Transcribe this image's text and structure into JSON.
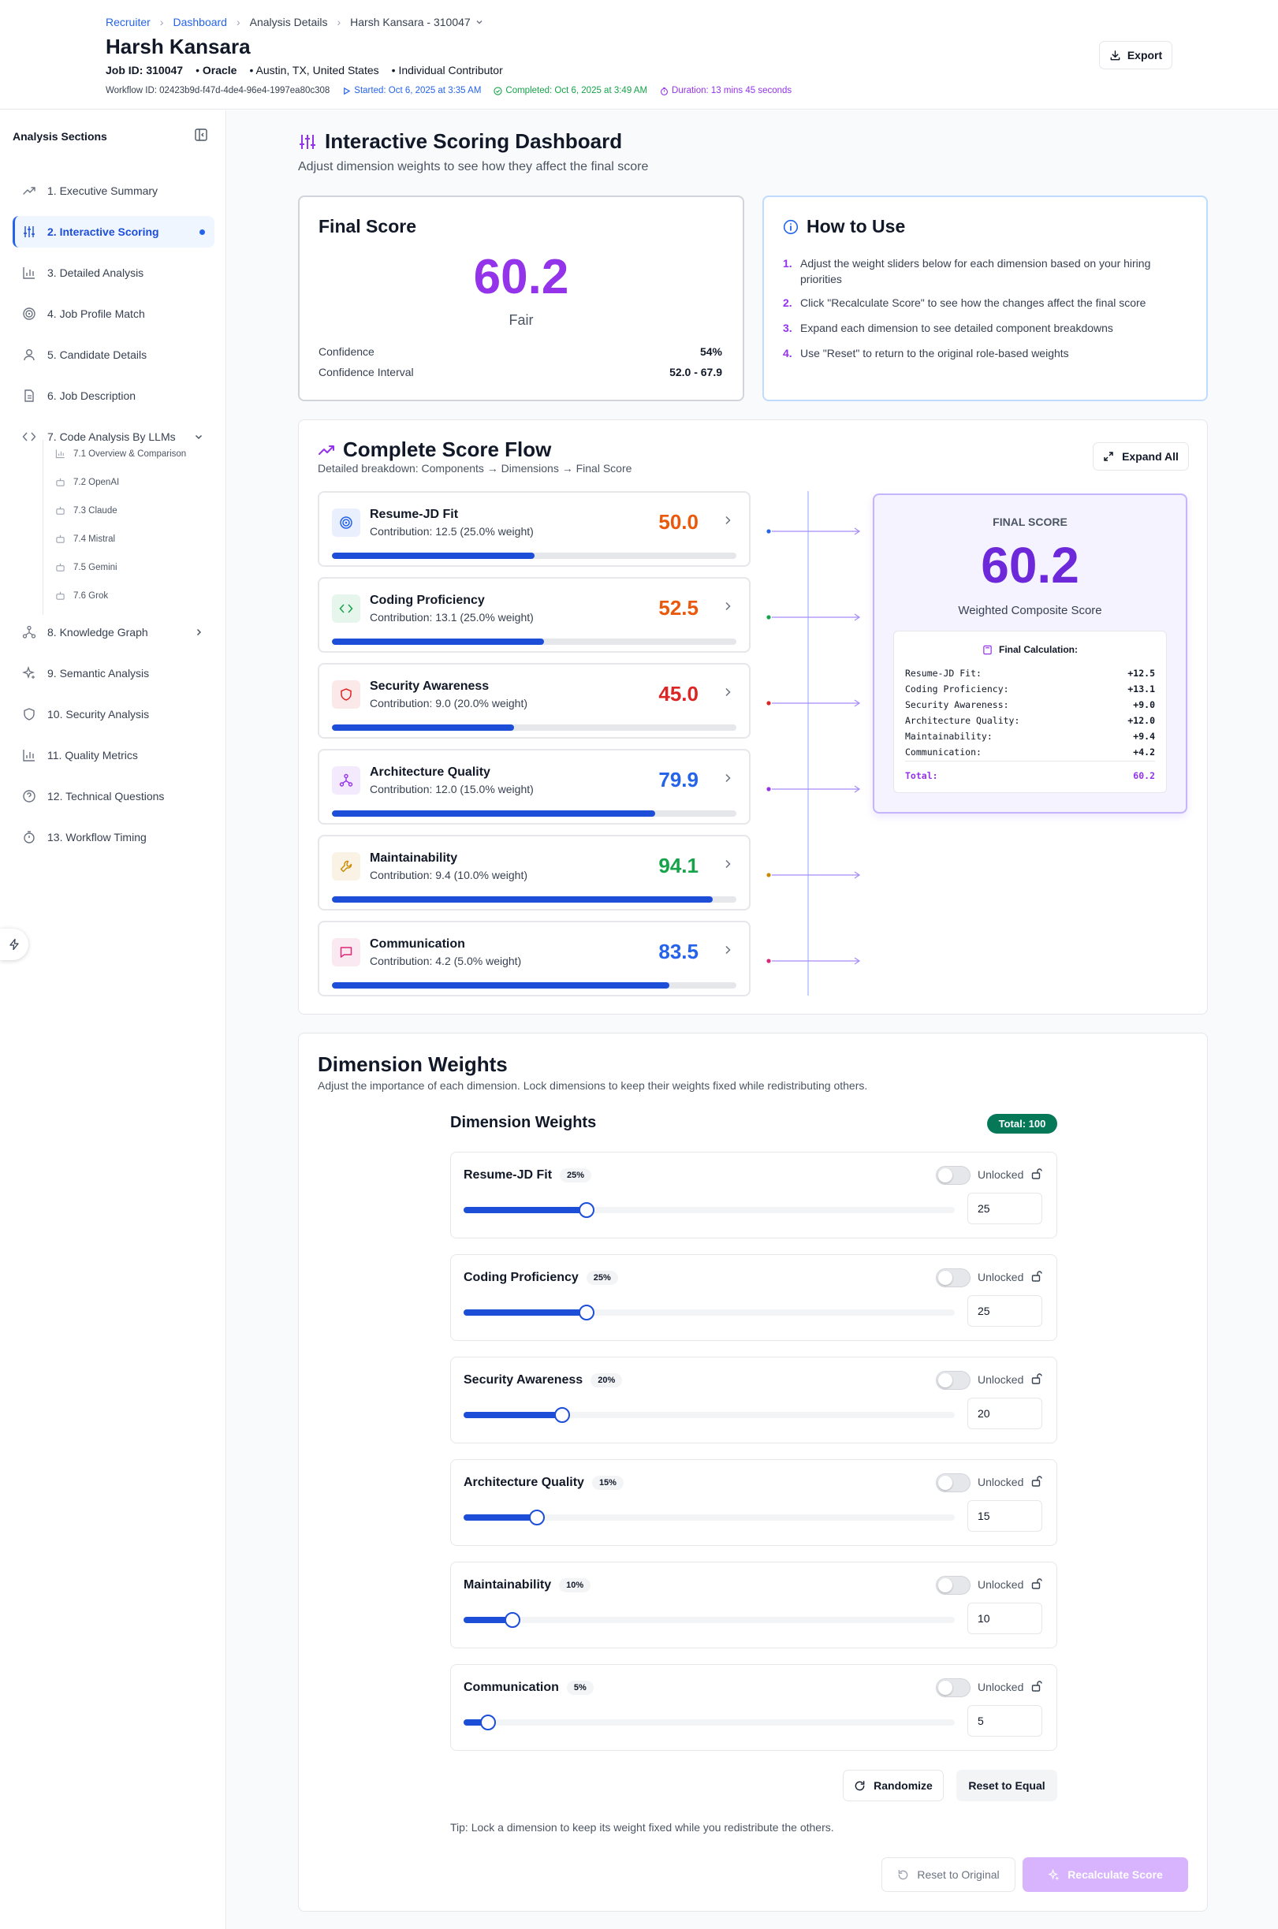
{
  "header": {
    "breadcrumb": [
      "Recruiter",
      "Dashboard",
      "Analysis Details",
      "Harsh Kansara - 310047"
    ],
    "candidate_name": "Harsh Kansara",
    "job_id": "Job ID: 310047",
    "company": "Oracle",
    "location": "Austin, TX, United States",
    "role": "Individual Contributor",
    "workflow_id": "Workflow ID: 02423b9d-f47d-4de4-96e4-1997ea80c308",
    "started": "Started: Oct 6, 2025 at 3:35 AM",
    "completed": "Completed: Oct 6, 2025 at 3:49 AM",
    "duration": "Duration: 13 mins 45 seconds",
    "export_label": "Export"
  },
  "sidebar": {
    "title": "Analysis Sections",
    "items": [
      {
        "label": "1. Executive Summary",
        "icon": "trending-up-icon"
      },
      {
        "label": "2. Interactive Scoring",
        "icon": "sliders-icon"
      },
      {
        "label": "3. Detailed Analysis",
        "icon": "bar-chart-icon"
      },
      {
        "label": "4. Job Profile Match",
        "icon": "target-icon"
      },
      {
        "label": "5. Candidate Details",
        "icon": "user-icon"
      },
      {
        "label": "6. Job Description",
        "icon": "file-icon"
      },
      {
        "label": "7. Code Analysis By LLMs",
        "icon": "code-icon"
      },
      {
        "label": "8. Knowledge Graph",
        "icon": "network-icon"
      },
      {
        "label": "9. Semantic Analysis",
        "icon": "sparkles-icon"
      },
      {
        "label": "10. Security Analysis",
        "icon": "shield-icon"
      },
      {
        "label": "11. Quality Metrics",
        "icon": "bar-chart-icon"
      },
      {
        "label": "12. Technical Questions",
        "icon": "help-circle-icon"
      },
      {
        "label": "13. Workflow Timing",
        "icon": "timer-icon"
      }
    ],
    "sub_items": [
      "7.1 Overview & Comparison",
      "7.2 OpenAI",
      "7.3 Claude",
      "7.4 Mistral",
      "7.5 Gemini",
      "7.6 Grok"
    ]
  },
  "page": {
    "title": "Interactive Scoring Dashboard",
    "subtitle": "Adjust dimension weights to see how they affect the final score"
  },
  "final_score": {
    "title": "Final Score",
    "value": "60.2",
    "rating": "Fair",
    "confidence_label": "Confidence",
    "confidence_value": "54%",
    "interval_label": "Confidence Interval",
    "interval_value": "52.0 - 67.9"
  },
  "how_to": {
    "title": "How to Use",
    "steps": [
      "Adjust the weight sliders below for each dimension based on your hiring priorities",
      "Click \"Recalculate Score\" to see how the changes affect the final score",
      "Expand each dimension to see detailed component breakdowns",
      "Use \"Reset\" to return to the original role-based weights"
    ]
  },
  "flow": {
    "title": "Complete Score Flow",
    "subtitle": "Detailed breakdown: Components → Dimensions → Final Score",
    "expand_label": "Expand All",
    "components": [
      {
        "name": "Resume-JD Fit",
        "contribution": "Contribution: 12.5 (25.0% weight)",
        "score": "50.0",
        "progress": 0.5,
        "score_color": "#ea580c",
        "accent": "#2563eb",
        "icon": "target-icon"
      },
      {
        "name": "Coding Proficiency",
        "contribution": "Contribution: 13.1 (25.0% weight)",
        "score": "52.5",
        "progress": 0.525,
        "score_color": "#ea580c",
        "accent": "#16a34a",
        "icon": "code-icon"
      },
      {
        "name": "Security Awareness",
        "contribution": "Contribution: 9.0 (20.0% weight)",
        "score": "45.0",
        "progress": 0.45,
        "score_color": "#dc2626",
        "accent": "#dc2626",
        "icon": "shield-icon"
      },
      {
        "name": "Architecture Quality",
        "contribution": "Contribution: 12.0 (15.0% weight)",
        "score": "79.9",
        "progress": 0.799,
        "score_color": "#2563eb",
        "accent": "#9333ea",
        "icon": "network-icon"
      },
      {
        "name": "Maintainability",
        "contribution": "Contribution: 9.4 (10.0% weight)",
        "score": "94.1",
        "progress": 0.941,
        "score_color": "#16a34a",
        "accent": "#ca8a04",
        "icon": "wrench-icon"
      },
      {
        "name": "Communication",
        "contribution": "Contribution: 4.2 (5.0% weight)",
        "score": "83.5",
        "progress": 0.835,
        "score_color": "#2563eb",
        "accent": "#db2777",
        "icon": "message-icon"
      }
    ],
    "final_box": {
      "title": "FINAL SCORE",
      "value": "60.2",
      "subtitle": "Weighted Composite Score",
      "calc_title": "Final Calculation:",
      "rows": [
        {
          "label": "Resume-JD Fit:",
          "value": "+12.5"
        },
        {
          "label": "Coding Proficiency:",
          "value": "+13.1"
        },
        {
          "label": "Security Awareness:",
          "value": "+9.0"
        },
        {
          "label": "Architecture Quality:",
          "value": "+12.0"
        },
        {
          "label": "Maintainability:",
          "value": "+9.4"
        },
        {
          "label": "Communication:",
          "value": "+4.2"
        }
      ],
      "total_label": "Total:",
      "total_value": "60.2"
    }
  },
  "weights": {
    "title": "Dimension Weights",
    "subtitle": "Adjust the importance of each dimension. Lock dimensions to keep their weights fixed while redistributing others.",
    "inner_title": "Dimension Weights",
    "total_badge": "Total: 100",
    "lock_label": "Unlocked",
    "rows": [
      {
        "name": "Resume-JD Fit",
        "pct": "25%",
        "value": "25",
        "level": 0.25
      },
      {
        "name": "Coding Proficiency",
        "pct": "25%",
        "value": "25",
        "level": 0.25
      },
      {
        "name": "Security Awareness",
        "pct": "20%",
        "value": "20",
        "level": 0.2
      },
      {
        "name": "Architecture Quality",
        "pct": "15%",
        "value": "15",
        "level": 0.15
      },
      {
        "name": "Maintainability",
        "pct": "10%",
        "value": "10",
        "level": 0.1
      },
      {
        "name": "Communication",
        "pct": "5%",
        "value": "5",
        "level": 0.05
      }
    ],
    "randomize_label": "Randomize",
    "equal_label": "Reset to Equal",
    "tip": "Tip: Lock a dimension to keep its weight fixed while you redistribute the others.",
    "reset_label": "Reset to Original",
    "recalc_label": "Recalculate Score"
  }
}
